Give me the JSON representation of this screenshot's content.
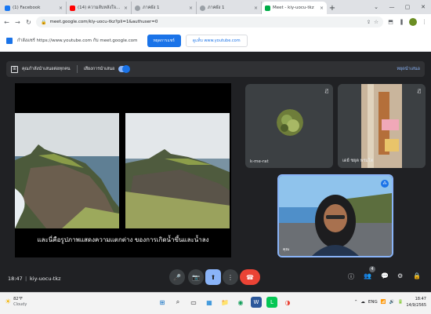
{
  "browser": {
    "tabs": [
      {
        "label": "(1) Facebook",
        "close": "×",
        "favicon_color": "#1877f2",
        "active": false
      },
      {
        "label": "(14) ความลับหลังใจคนไทย",
        "close": "×",
        "favicon_color": "#ff0000",
        "active": false
      },
      {
        "label": "ภาคผัง 1",
        "close": "×",
        "favicon_color": "#9aa0a6",
        "active": false
      },
      {
        "label": "ภาคผัง 1",
        "close": "×",
        "favicon_color": "#9aa0a6",
        "active": false
      },
      {
        "label": "Meet - kiy-uocu-tkz",
        "close": "×",
        "favicon_color": "#00ac47",
        "active": true
      }
    ],
    "new_tab": "+",
    "window_controls": [
      "⌄",
      "—",
      "▢",
      "✕"
    ],
    "url": "meet.google.com/kiy-uocu-tkz?pli=1&authuser=0",
    "nav": {
      "back": "←",
      "forward": "→",
      "reload": "↻"
    },
    "omnibox_icons": [
      "⇪",
      "☆"
    ],
    "extension_icons": [
      "⬒",
      "❚",
      "⋮"
    ]
  },
  "share_notification": {
    "text": "กำลังแชร์ https://www.youtube.com กับ meet.google.com",
    "stop_button": "หยุดการแชร์",
    "switch_button": "ดูแท็บ www.youtube.com"
  },
  "presenting_bar": {
    "icon": "⊞",
    "message": "คุณกำลังนำเสนอต่อทุกคน",
    "audio_label": "เสียงการนำเสนอ",
    "stop_label": "หยุดนำเสนอ"
  },
  "stage": {
    "caption": "และนี่คือรูปภาพแสดงความแตกต่าง ของการเกิดน้ำขึ้นและน้ำลง"
  },
  "participants": [
    {
      "name": "k-me-rat",
      "muted_icon": "🎙̸"
    },
    {
      "name": "เดย์ ชยุต พรมโต",
      "muted_icon": "🎙̸"
    }
  ],
  "self_tile": {
    "label": "คุณ",
    "pin_icon": "⁂"
  },
  "controls": {
    "time": "18:47",
    "separator": "|",
    "meeting_code": "kiy-uocu-tkz",
    "mic_icon": "🎤",
    "camera_icon": "📷",
    "present_icon": "⬆",
    "more_icon": "⋮",
    "end_icon": "☎",
    "info_icon": "ⓘ",
    "people_icon": "👥",
    "people_count": "4",
    "chat_icon": "💬",
    "activities_icon": "⚙",
    "host_icon": "🔒"
  },
  "taskbar": {
    "weather_temp": "82°F",
    "weather_desc": "Cloudy",
    "weather_icon": "☀",
    "apps": [
      "⊞",
      "⌕",
      "▭",
      "▦",
      "📁",
      "◉",
      "W",
      "L",
      "◑"
    ],
    "tray_icons": [
      "⌃",
      "☁",
      "ENG",
      "📶",
      "🔊",
      "🔋"
    ],
    "time": "18:47",
    "date": "14/9/2565"
  }
}
